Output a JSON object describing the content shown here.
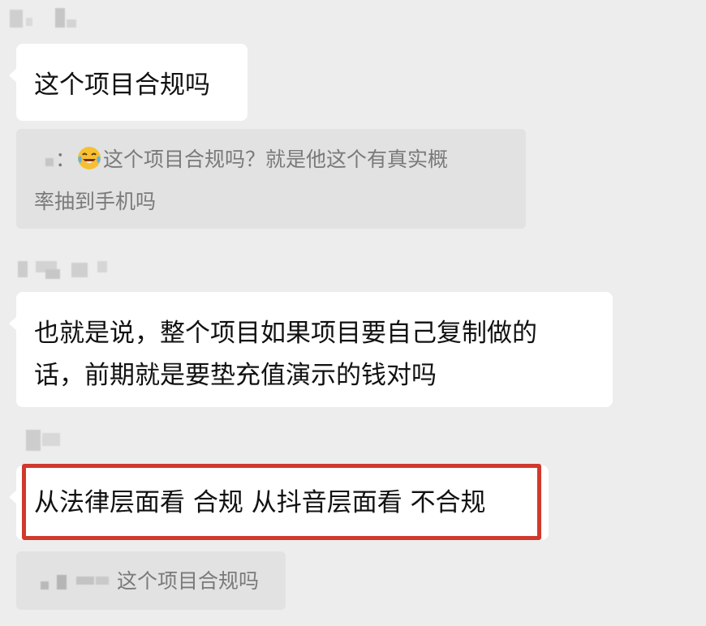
{
  "messages": [
    {
      "text": "这个项目合规吗"
    },
    {
      "text_line1": "也就是说，整个项目如果项目要自己复制做的",
      "text_line2": "话，前期就是要垫充值演示的钱对吗"
    },
    {
      "text": "从法律层面看 合规 从抖音层面看 不合规",
      "highlighted": true
    }
  ],
  "quotes": [
    {
      "colon": "：",
      "emoji_icon": "laughing-crying-emoji-icon",
      "line1": "这个项目合规吗？就是他这个有真实概",
      "line2": "率抽到手机吗"
    },
    {
      "text": "这个项目合规吗"
    }
  ],
  "colors": {
    "background": "#ededed",
    "bubble": "#ffffff",
    "quote_bg": "#e2e2e2",
    "quote_text": "#7a7a7a",
    "highlight_border": "#d0392d"
  }
}
